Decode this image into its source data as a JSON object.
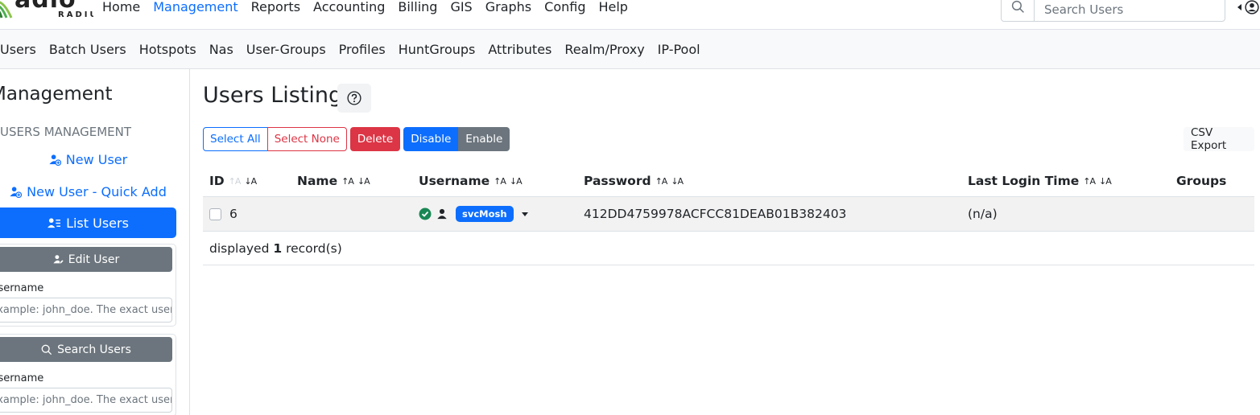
{
  "brand": {
    "big": "adio",
    "small": "RADIUS"
  },
  "main_menu": [
    {
      "label": "Home",
      "active": false
    },
    {
      "label": "Management",
      "active": true
    },
    {
      "label": "Reports",
      "active": false
    },
    {
      "label": "Accounting",
      "active": false
    },
    {
      "label": "Billing",
      "active": false
    },
    {
      "label": "GIS",
      "active": false
    },
    {
      "label": "Graphs",
      "active": false
    },
    {
      "label": "Config",
      "active": false
    },
    {
      "label": "Help",
      "active": false
    }
  ],
  "search": {
    "placeholder": "Search Users"
  },
  "sub_menu": [
    "Users",
    "Batch Users",
    "Hotspots",
    "Nas",
    "User-Groups",
    "Profiles",
    "HuntGroups",
    "Attributes",
    "Realm/Proxy",
    "IP-Pool"
  ],
  "sidebar": {
    "title": "Management",
    "section": "USERS MANAGEMENT",
    "new_user": "New User",
    "quick_add": "New User - Quick Add",
    "list_users": "List Users",
    "edit_user": {
      "button": "Edit User",
      "label": "Username",
      "placeholder": "Example: john_doe. The exact username"
    },
    "search_users": {
      "button": "Search Users",
      "label": "Username",
      "placeholder": "Example: john_doe. The exact username"
    }
  },
  "page": {
    "title": "Users Listing",
    "toolbar": {
      "select_all": "Select All",
      "select_none": "Select None",
      "delete": "Delete",
      "disable": "Disable",
      "enable": "Enable",
      "csv_export": "CSV Export"
    },
    "columns": [
      "ID",
      "Name",
      "Username",
      "Password",
      "Last Login Time",
      "Groups"
    ],
    "rows": [
      {
        "id": "6",
        "name": "",
        "username": "svcMosh",
        "password": "412DD4759978ACFCC81DEAB01B382403",
        "last_login": "(n/a)",
        "groups": ""
      }
    ],
    "footer": {
      "prefix": "displayed",
      "count": "1",
      "suffix": "record(s)"
    }
  },
  "colors": {
    "primary": "#0d6efd",
    "danger": "#dc3545",
    "secondary": "#6c757d",
    "success": "#198754"
  }
}
